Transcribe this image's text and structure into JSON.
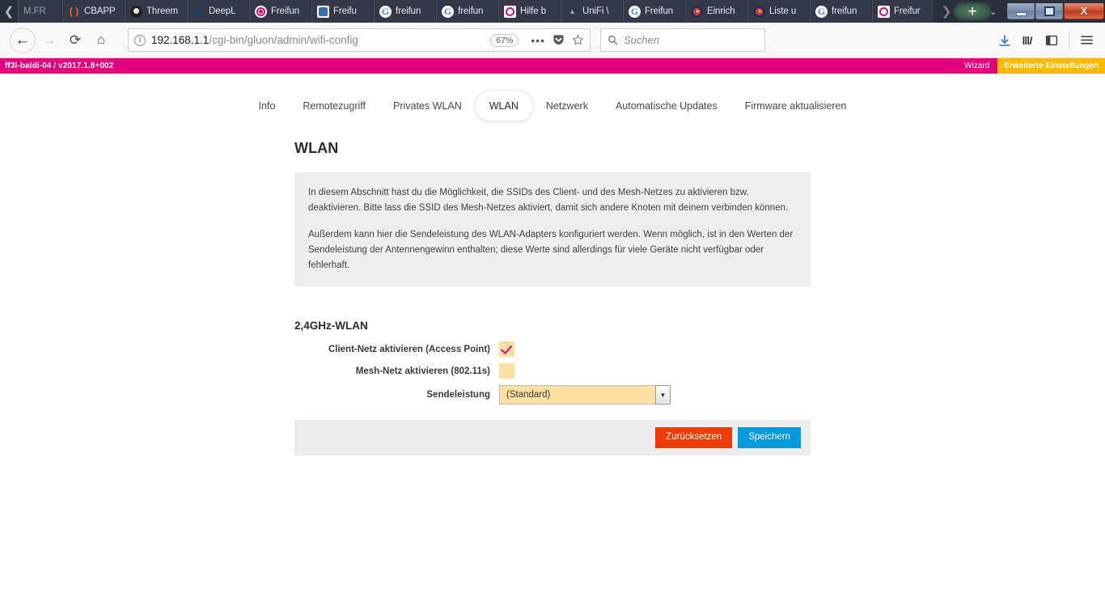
{
  "browser": {
    "tabs": [
      {
        "label": "M.FR",
        "icon": "generic-favicon",
        "cut": true
      },
      {
        "label": "CBAPP",
        "icon": "cbapp-favicon"
      },
      {
        "label": "Threem",
        "icon": "threema-favicon"
      },
      {
        "label": "DeepL",
        "icon": "deepl-favicon"
      },
      {
        "label": "Freifun",
        "icon": "freifunk-favicon"
      },
      {
        "label": "Freifu",
        "icon": "freifunk-blue-favicon"
      },
      {
        "label": "freifun",
        "icon": "google-favicon"
      },
      {
        "label": "freifun",
        "icon": "google-favicon"
      },
      {
        "label": "Hilfe b",
        "icon": "hilfe-favicon"
      },
      {
        "label": "UniFi \\",
        "icon": "unifi-favicon"
      },
      {
        "label": "Freifun",
        "icon": "google-favicon"
      },
      {
        "label": "Einrich",
        "icon": "dot-favicon"
      },
      {
        "label": "Liste u",
        "icon": "dot-favicon"
      },
      {
        "label": "freifun",
        "icon": "google-favicon"
      },
      {
        "label": "Freifur",
        "icon": "freifunk-last-favicon"
      }
    ],
    "scroll_left_icon": "chevron-left-icon",
    "scroll_right_icon": "chevron-right-icon",
    "new_tab_icon": "plus-icon",
    "list_all_tabs_icon": "chevron-down-icon",
    "window_controls": {
      "minimize": "minimize-icon",
      "maximize": "maximize-icon",
      "close": "X"
    },
    "nav": {
      "back_icon": "back-arrow-icon",
      "forward_icon": "forward-arrow-icon",
      "reload_icon": "reload-icon",
      "home_icon": "home-icon"
    },
    "url": {
      "info_icon": "info-icon",
      "host": "192.168.1.1",
      "path": "/cgi-bin/gluon/admin/wifi-config",
      "zoom_level": "67%",
      "page_actions_icon": "ellipsis-icon",
      "pocket_icon": "pocket-icon",
      "bookmark_icon": "star-icon"
    },
    "search": {
      "icon": "search-icon",
      "placeholder": "Suchen",
      "value": ""
    },
    "toolbar_right": {
      "downloads_icon": "download-icon",
      "library_icon": "library-icon",
      "sidebar_icon": "sidebar-icon",
      "menu_icon": "hamburger-menu-icon"
    }
  },
  "gluon": {
    "node_name": "ff3l-baldi-04 / v2017.1.8+002",
    "wizard_link": "Wizard",
    "advanced_link": "Erweiterte Einstellungen",
    "accent_color": "#e5007d",
    "advanced_color": "#fbb900"
  },
  "nav_tabs": [
    {
      "label": "Info",
      "active": false
    },
    {
      "label": "Remotezugriff",
      "active": false
    },
    {
      "label": "Privates WLAN",
      "active": false
    },
    {
      "label": "WLAN",
      "active": true
    },
    {
      "label": "Netzwerk",
      "active": false
    },
    {
      "label": "Automatische Updates",
      "active": false
    },
    {
      "label": "Firmware aktualisieren",
      "active": false
    }
  ],
  "main": {
    "title": "WLAN",
    "notice_paragraph_1": "In diesem Abschnitt hast du die Möglichkeit, die SSIDs des Client- und des Mesh-Netzes zu aktivieren bzw. deaktivieren. Bitte lass die SSID des Mesh-Netzes aktiviert, damit sich andere Knoten mit deinem verbinden können.",
    "notice_paragraph_2": "Außerdem kann hier die Sendeleistung des WLAN-Adapters konfiguriert werden. Wenn möglich, ist in den Werten der Sendeleistung der Antennengewinn enthalten; diese Werte sind allerdings für viele Geräte nicht verfügbar oder fehlerhaft.",
    "section_title": "2,4GHz-WLAN",
    "fields": {
      "client_net_label": "Client-Netz aktivieren (Access Point)",
      "client_net_checked": true,
      "mesh_net_label": "Mesh-Netz aktivieren (802.11s)",
      "mesh_net_checked": false,
      "txpower_label": "Sendeleistung",
      "txpower_value": "(Standard)",
      "txpower_arrow_icon": "chevron-down-icon"
    },
    "buttons": {
      "reset": "Zurücksetzen",
      "save": "Speichern",
      "reset_color": "#ef3b06",
      "save_color": "#0099db"
    }
  }
}
